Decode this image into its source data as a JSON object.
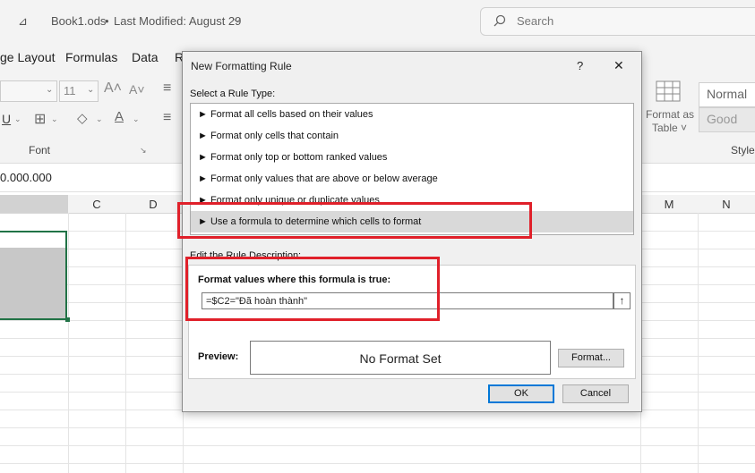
{
  "titlebar": {
    "qat_dropdown": "⊿",
    "filename": "Book1.ods",
    "separator": "•",
    "last_modified": "Last Modified: August 29",
    "search_placeholder": "Search"
  },
  "menu": {
    "items": [
      "ge Layout",
      "Formulas",
      "Data",
      "R"
    ]
  },
  "ribbon": {
    "font_size": "11",
    "grow_font": "A˄",
    "shrink_font": "A˅",
    "underline": "U",
    "font_group_label": "Font",
    "format_as_table_line1": "Format as",
    "format_as_table_line2": "Table ˅",
    "style_normal": "Normal",
    "style_good": "Good",
    "styles_group_label": "Styles"
  },
  "formula_bar": {
    "value": "0.000.000"
  },
  "columns": [
    "C",
    "D",
    "M",
    "N"
  ],
  "dialog": {
    "title": "New Formatting Rule",
    "help": "?",
    "close": "✕",
    "select_rule_type_label": "Select a Rule Type:",
    "rule_types": [
      "► Format all cells based on their values",
      "► Format only cells that contain",
      "► Format only top or bottom ranked values",
      "► Format only values that are above or below average",
      "► Format only unique or duplicate values",
      "► Use a formula to determine which cells to format"
    ],
    "edit_description_label": "Edit the Rule Description:",
    "formula_label": "Format values where this formula is true:",
    "formula_value": "=$C2=\"Đã hoàn thành\"",
    "preview_label": "Preview:",
    "preview_text": "No Format Set",
    "format_button": "Format...",
    "ok_button": "OK",
    "cancel_button": "Cancel"
  },
  "colors": {
    "highlight_red": "#e0202a",
    "accent_blue": "#0078d7",
    "selection_gray": "#d9d9d9",
    "cell_range_green": "#217346"
  }
}
